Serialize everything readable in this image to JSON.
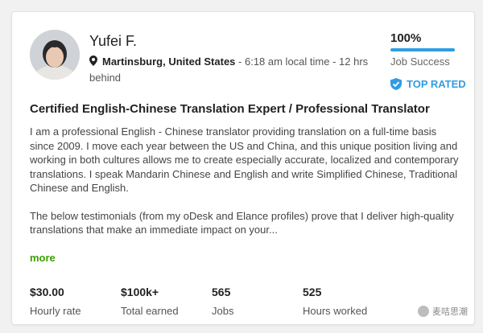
{
  "profile": {
    "name": "Yufei F.",
    "location": "Martinsburg, United States",
    "local_time": " - 6:18 am local time - 12 hrs behind"
  },
  "job_success": {
    "percent": "100%",
    "value": 1.0,
    "label": "Job Success"
  },
  "badge": {
    "label": "TOP RATED",
    "icon": "shield-check-icon"
  },
  "title": "Certified English-Chinese Translation Expert / Professional Translator",
  "description": [
    "I am a professional English - Chinese translator providing translation on a full-time basis since 2009. I move each year between the US and China, and this unique position living and working in both cultures allows me to create especially accurate, localized and contemporary translations. I speak Mandarin Chinese and English and write Simplified Chinese, Traditional Chinese and English.",
    "The below testimonials (from my oDesk and Elance profiles) prove that I deliver high-quality translations that make an immediate impact on your..."
  ],
  "more_label": "more",
  "stats": [
    {
      "value": "$30.00",
      "label": "Hourly rate"
    },
    {
      "value": "$100k+",
      "label": "Total earned"
    },
    {
      "value": "565",
      "label": "Jobs"
    },
    {
      "value": "525",
      "label": "Hours worked"
    }
  ],
  "watermark": "麦咭思潮",
  "colors": {
    "accent_blue": "#2f9de2",
    "link_green": "#37a000"
  }
}
